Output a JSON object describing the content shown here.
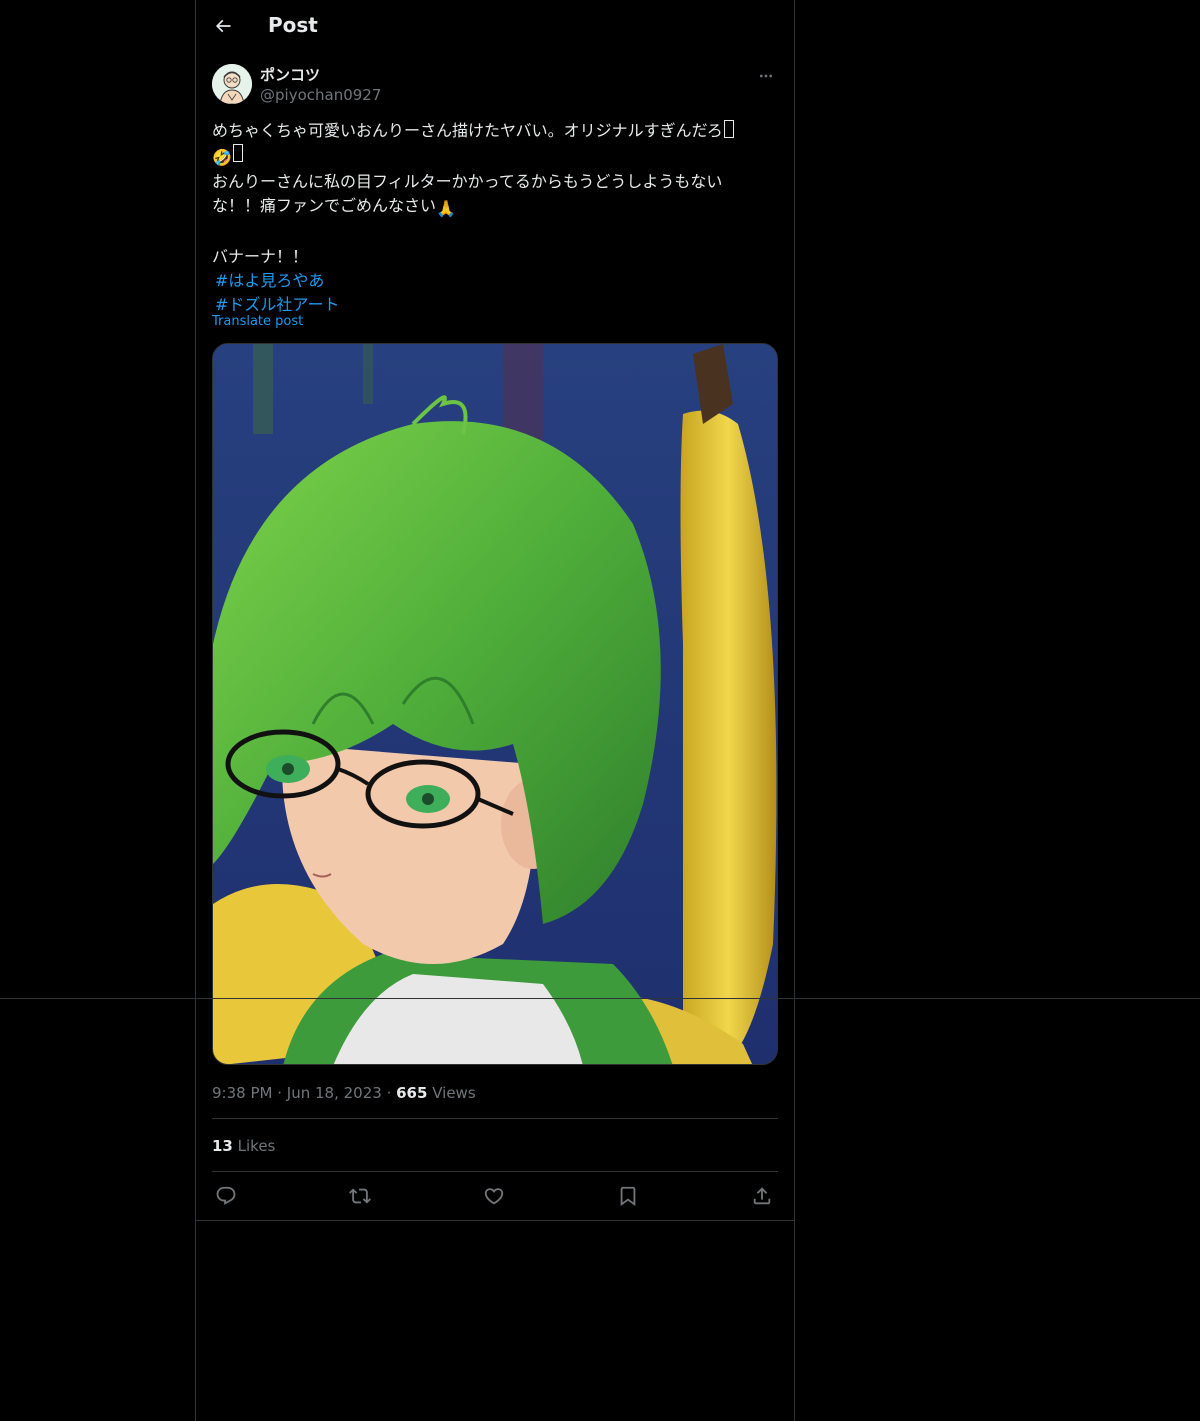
{
  "header": {
    "title": "Post"
  },
  "author": {
    "display_name": "ポンコツ",
    "handle": "@piyochan0927"
  },
  "post": {
    "line1": "めちゃくちゃ可愛いおんりーさん描けたヤバい。オリジナルすぎんだろ",
    "line2_emoji": "🤣",
    "line3": "おんりーさんに私の目フィルターかかってるからもうどうしようもない",
    "line4": "な！！痛ファンでごめんなさい",
    "line4_emoji": "🙏",
    "line5": "バナーナ！！",
    "hashtags": [
      "#はよ見ろやあ",
      "#ドズル社アート"
    ],
    "translate_label": "Translate post"
  },
  "meta": {
    "time": "9:38 PM",
    "date": "Jun 18, 2023",
    "views_count": "665",
    "views_label": "Views"
  },
  "engagement": {
    "likes_count": "13",
    "likes_label": "Likes"
  },
  "icons": {
    "back": "back-arrow-icon",
    "more": "more-icon",
    "reply": "reply-icon",
    "repost": "repost-icon",
    "like": "like-icon",
    "bookmark": "bookmark-icon",
    "share": "share-icon"
  },
  "colors": {
    "background": "#000000",
    "text": "#e7e9ea",
    "secondary": "#71767b",
    "accent": "#1d9bf0",
    "border": "#2f3336"
  }
}
